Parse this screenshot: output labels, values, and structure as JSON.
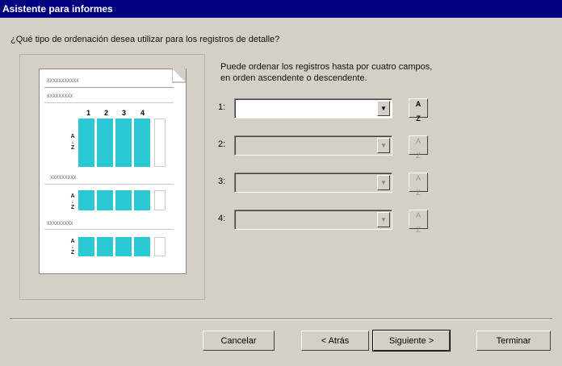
{
  "window": {
    "title": "Asistente para informes"
  },
  "question": "¿Qué tipo de ordenación desea utilizar para los registros de detalle?",
  "instruction": {
    "line1": "Puede ordenar los registros hasta por cuatro campos,",
    "line2": "en orden ascendente o descendente."
  },
  "preview": {
    "title_placeholder": "XXXXXXXXXXX",
    "group_placeholder": "XXXXXXXXX",
    "column_numbers": [
      "1",
      "2",
      "3",
      "4"
    ],
    "sort_glyph_top": "A",
    "sort_glyph_bottom": "Z"
  },
  "sort_rows": [
    {
      "number": "1:",
      "value": "",
      "enabled": true,
      "sort_top": "A",
      "sort_bottom": "Z"
    },
    {
      "number": "2:",
      "value": "",
      "enabled": false,
      "sort_top": "A",
      "sort_bottom": "Z"
    },
    {
      "number": "3:",
      "value": "",
      "enabled": false,
      "sort_top": "A",
      "sort_bottom": "Z"
    },
    {
      "number": "4:",
      "value": "",
      "enabled": false,
      "sort_top": "A",
      "sort_bottom": "Z"
    }
  ],
  "combo_arrow": "▼",
  "buttons": {
    "cancel": "Cancelar",
    "back": "< Atrás",
    "next": "Siguiente >",
    "finish": "Terminar"
  },
  "colors": {
    "titlebar": "#000080",
    "dialog": "#d4d0c8",
    "preview_cells": "#29c8d2"
  }
}
